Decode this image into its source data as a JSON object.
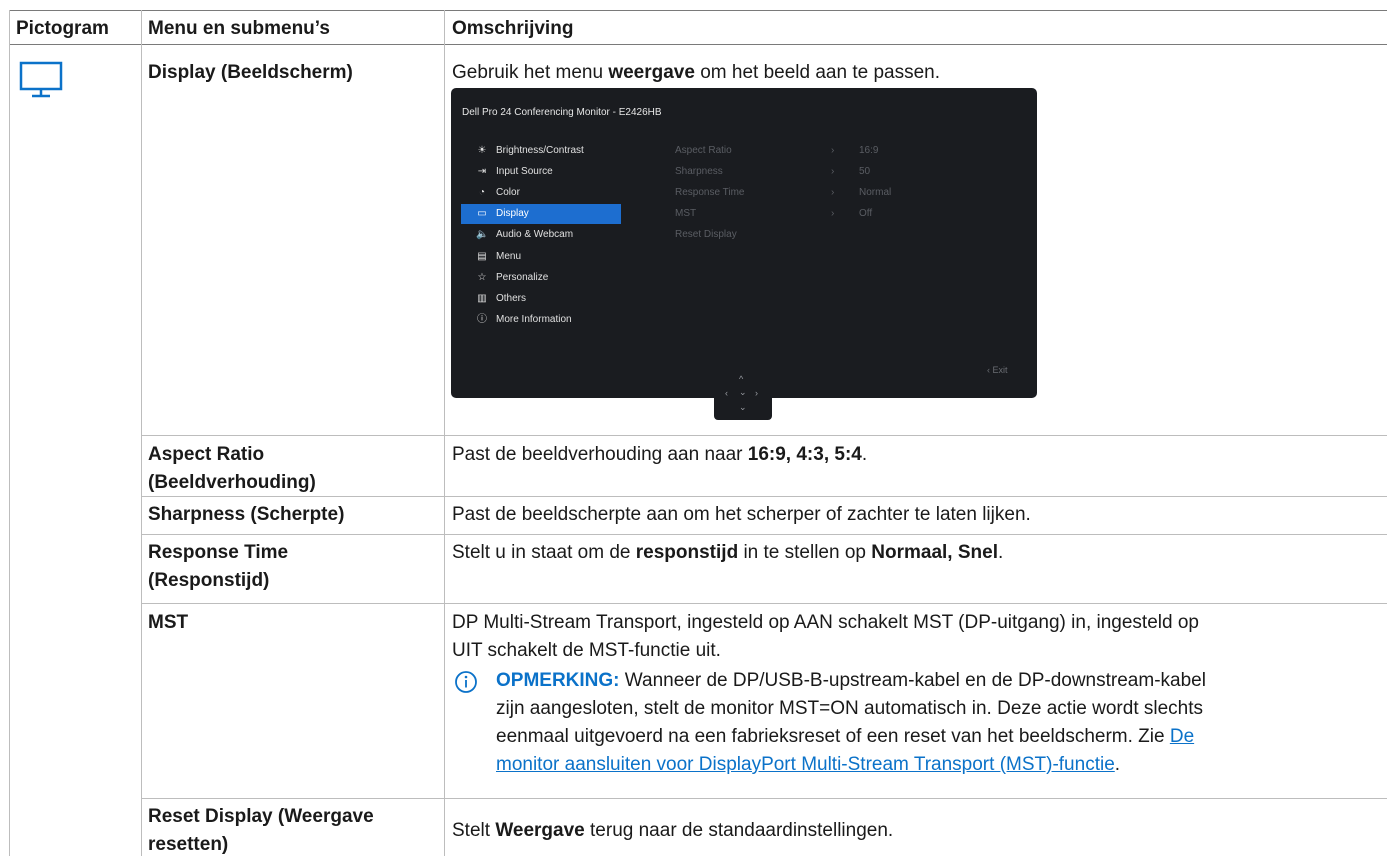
{
  "headers": {
    "col1": "Pictogram",
    "col2": "Menu en submenu’s",
    "col3": "Omschrijving"
  },
  "icon": "monitor-icon",
  "accent_color": "#0b72c9",
  "rows": {
    "display": {
      "title": "Display (Beeldscherm)",
      "desc_a": "Gebruik het menu ",
      "desc_b": "weergave",
      "desc_c": " om het beeld aan te passen."
    },
    "aspect": {
      "title1": "Aspect Ratio",
      "title2": "(Beeldverhouding)",
      "desc_a": "Past de beeldverhouding aan naar ",
      "desc_b": "16:9, 4:3, 5:4",
      "desc_c": "."
    },
    "sharpness": {
      "title": "Sharpness (Scherpte)",
      "desc": "Past de beeldscherpte aan om het scherper of zachter te laten lijken."
    },
    "response": {
      "title1": "Response Time",
      "title2": "(Responstijd)",
      "desc_a": "Stelt u in staat om de ",
      "desc_b": "responstijd",
      "desc_c": " in te stellen op ",
      "desc_d": "Normaal, Snel",
      "desc_e": "."
    },
    "mst": {
      "title": "MST",
      "line1": "DP Multi-Stream Transport, ingesteld op AAN schakelt MST (DP-uitgang) in, ingesteld op",
      "line2": "UIT schakelt de MST-functie uit.",
      "note_label": "OPMERKING:",
      "note1": " Wanneer de DP/USB-B-upstream-kabel en de DP-downstream-kabel",
      "note2": "zijn aangesloten, stelt de monitor MST=ON automatisch in. Deze actie wordt slechts",
      "note3a": "eenmaal uitgevoerd na een fabrieksreset of een reset van het beeldscherm. Zie ",
      "note3b": "De",
      "note4a": "monitor aansluiten voor DisplayPort Multi-Stream Transport (MST)-functie",
      "note4b": "."
    },
    "reset": {
      "title1": "Reset Display (Weergave",
      "title2": "resetten)",
      "desc_a": "Stelt ",
      "desc_b": "Weergave",
      "desc_c": " terug naar de standaardinstellingen."
    }
  },
  "osd": {
    "title": "Dell Pro 24 Conferencing Monitor - E2426HB",
    "menu": [
      {
        "icon": "brightness-icon",
        "glyph": "☀",
        "label": "Brightness/Contrast"
      },
      {
        "icon": "input-source-icon",
        "glyph": "⇥",
        "label": "Input Source"
      },
      {
        "icon": "color-icon",
        "glyph": "◔",
        "label": "Color"
      },
      {
        "icon": "display-icon",
        "glyph": "▭",
        "label": "Display"
      },
      {
        "icon": "audio-icon",
        "glyph": "🔈",
        "label": "Audio & Webcam"
      },
      {
        "icon": "menu-icon",
        "glyph": "▤",
        "label": "Menu"
      },
      {
        "icon": "star-icon",
        "glyph": "☆",
        "label": "Personalize"
      },
      {
        "icon": "others-icon",
        "glyph": "▥",
        "label": "Others"
      },
      {
        "icon": "info-icon",
        "glyph": "ⓘ",
        "label": "More Information"
      }
    ],
    "submenu": [
      {
        "label": "Aspect Ratio",
        "arrow": "›",
        "value": "16:9"
      },
      {
        "label": "Sharpness",
        "arrow": "›",
        "value": "50"
      },
      {
        "label": "Response Time",
        "arrow": "›",
        "value": "Normal"
      },
      {
        "label": "MST",
        "arrow": "›",
        "value": "Off"
      },
      {
        "label": "Reset Display",
        "arrow": "",
        "value": ""
      }
    ],
    "exit": "‹  Exit",
    "joystick": {
      "up": "^",
      "left": "‹",
      "center": "⌄",
      "right": "›",
      "down": "⌄"
    }
  }
}
